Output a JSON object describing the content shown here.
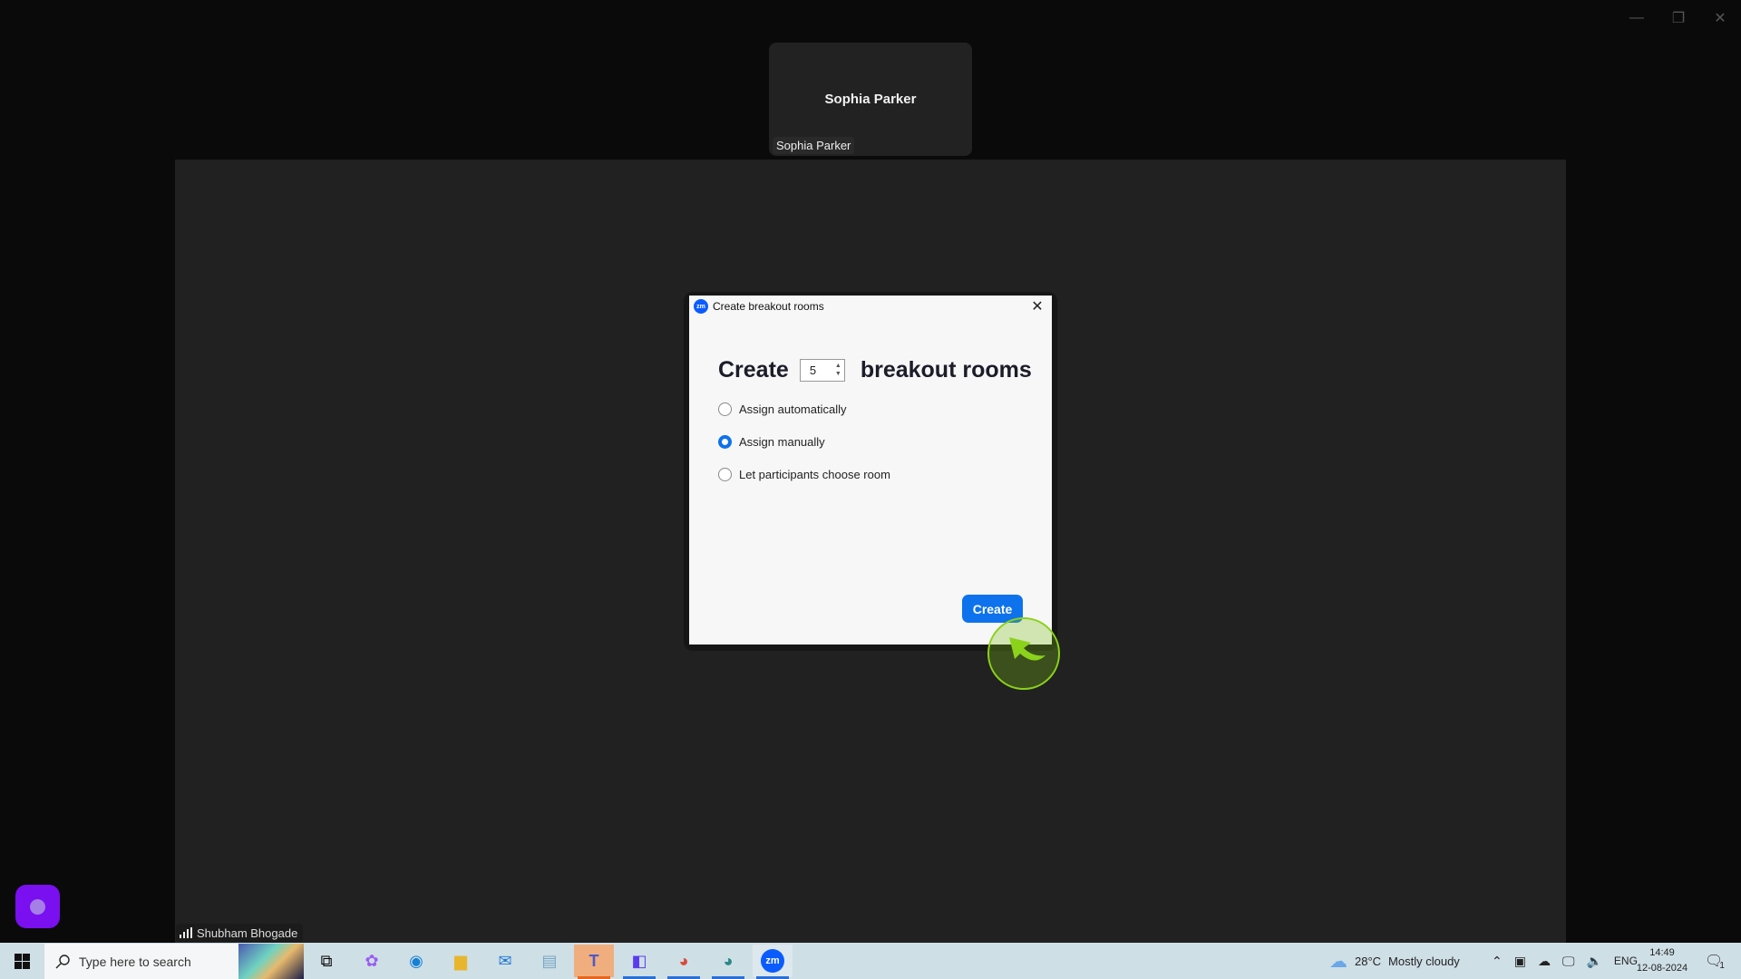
{
  "window_controls": {
    "minimize": "—",
    "restore": "❐",
    "close": "✕"
  },
  "participants": {
    "thumbnail": {
      "center_name": "Sophia Parker",
      "name_tag": "Sophia Parker"
    },
    "main": {
      "name_tag": "Shubham Bhogade"
    }
  },
  "dialog": {
    "title": "Create breakout rooms",
    "logo_text": "zm",
    "close_icon": "✕",
    "headline_prefix": "Create",
    "room_count": "5",
    "headline_suffix": "breakout rooms",
    "options": [
      {
        "label": "Assign automatically",
        "selected": false
      },
      {
        "label": "Assign manually",
        "selected": true
      },
      {
        "label": "Let participants choose room",
        "selected": false
      }
    ],
    "create_button": "Create"
  },
  "taskbar": {
    "search_placeholder": "Type here to search",
    "apps": [
      "Task View",
      "Copilot",
      "Microsoft Edge",
      "File Explorer",
      "Mail",
      "Notepad",
      "Microsoft Teams",
      "Files",
      "Google Chrome",
      "Google Chrome (S)",
      "Zoom"
    ],
    "weather": {
      "temp": "28°C",
      "condition": "Mostly cloudy"
    },
    "language": "ENG",
    "time": "14:49",
    "date": "12-08-2024",
    "notifications_count": "1"
  },
  "colors": {
    "accent": "#0e72ed",
    "highlight_cursor": "#8bd21b",
    "purple_button": "#7a0ff0"
  }
}
